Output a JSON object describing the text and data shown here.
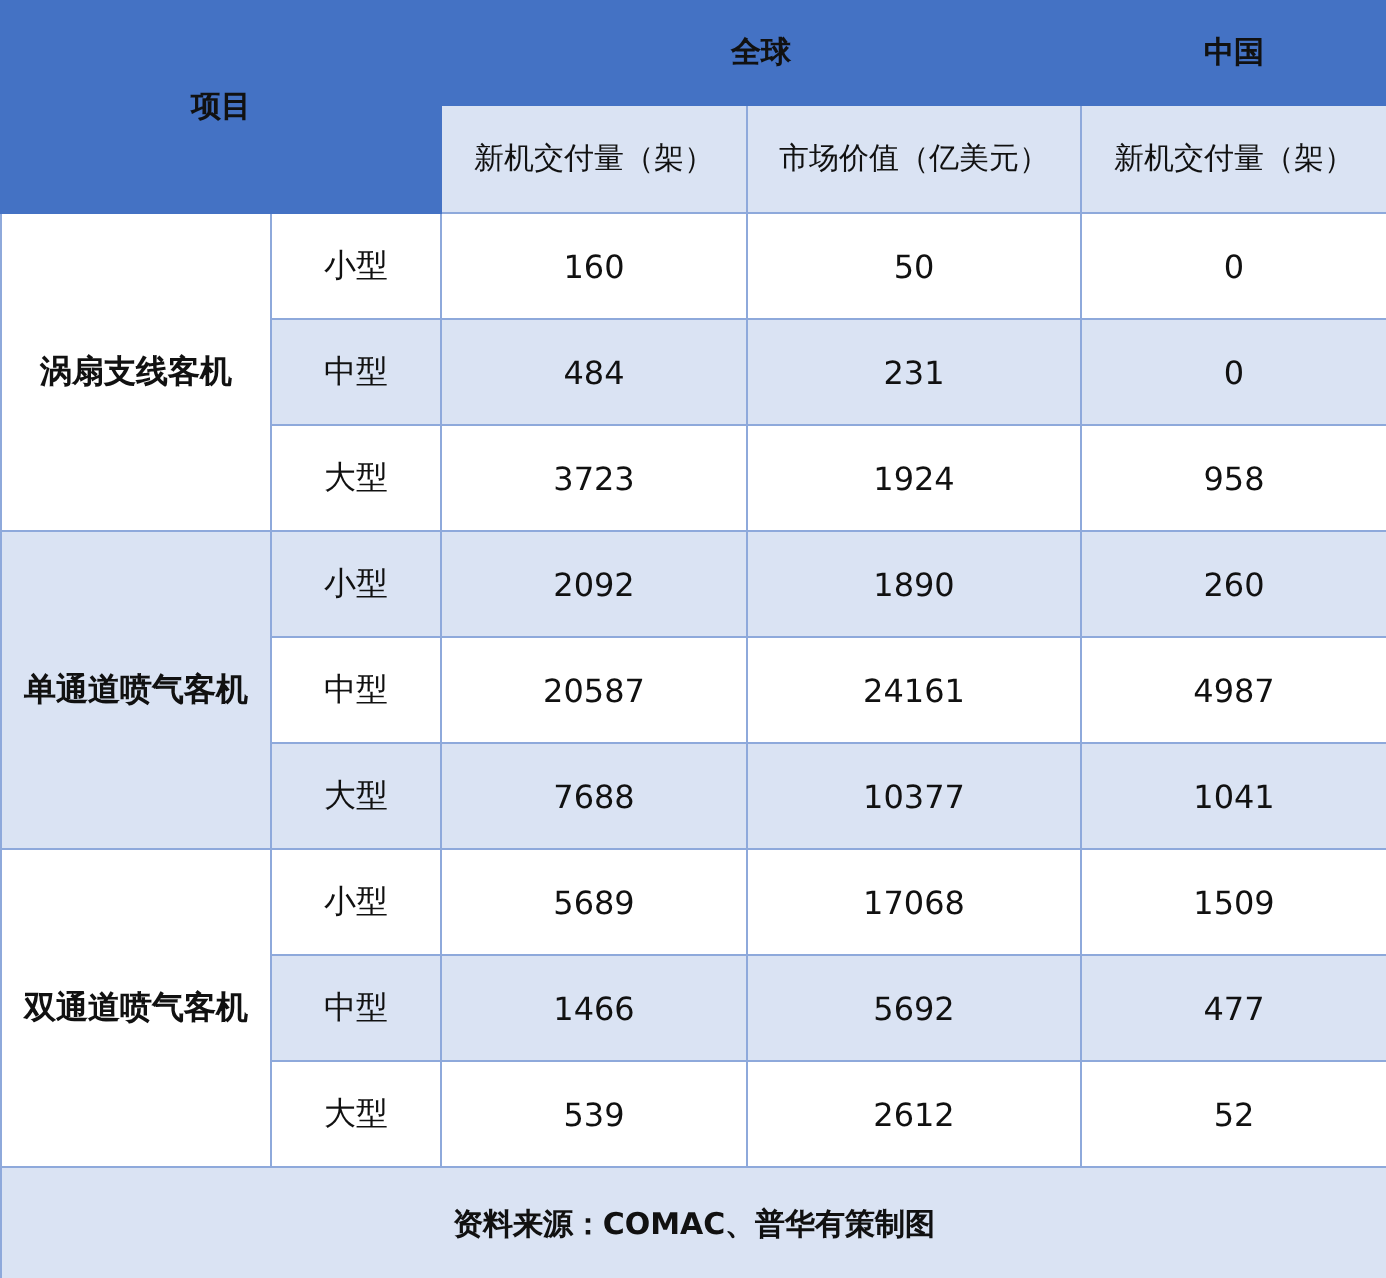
{
  "header": {
    "item_label": "项目",
    "global_label": "全球",
    "china_label": "中国",
    "columns": [
      "新机交付量（架）",
      "市场价值（亿美元）",
      "新机交付量（架）"
    ]
  },
  "groups": [
    {
      "name": "涡扇支线客机",
      "rows": [
        {
          "size": "小型",
          "values": [
            "160",
            "50",
            "0"
          ]
        },
        {
          "size": "中型",
          "values": [
            "484",
            "231",
            "0"
          ]
        },
        {
          "size": "大型",
          "values": [
            "3723",
            "1924",
            "958"
          ]
        }
      ]
    },
    {
      "name": "单通道喷气客机",
      "rows": [
        {
          "size": "小型",
          "values": [
            "2092",
            "1890",
            "260"
          ]
        },
        {
          "size": "中型",
          "values": [
            "20587",
            "24161",
            "4987"
          ]
        },
        {
          "size": "大型",
          "values": [
            "7688",
            "10377",
            "1041"
          ]
        }
      ]
    },
    {
      "name": "双通道喷气客机",
      "rows": [
        {
          "size": "小型",
          "values": [
            "5689",
            "17068",
            "1509"
          ]
        },
        {
          "size": "中型",
          "values": [
            "1466",
            "5692",
            "477"
          ]
        },
        {
          "size": "大型",
          "values": [
            "539",
            "2612",
            "52"
          ]
        }
      ]
    }
  ],
  "source": "资料来源：COMAC、普华有策制图"
}
